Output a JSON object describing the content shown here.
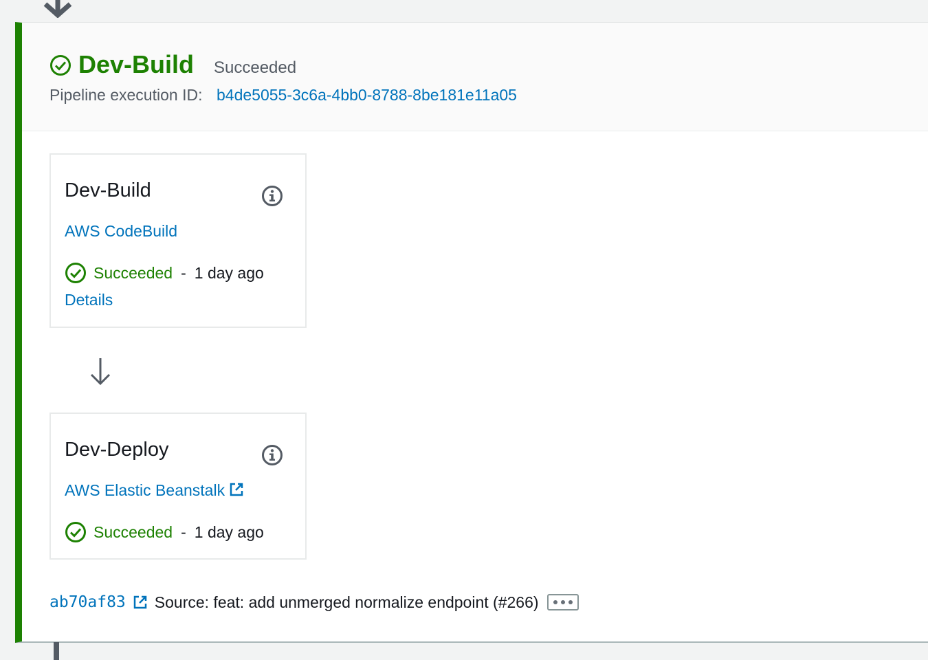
{
  "stage": {
    "title": "Dev-Build",
    "status": "Succeeded",
    "execution_id_label": "Pipeline execution ID:",
    "execution_id": "b4de5055-3c6a-4bb0-8788-8be181e11a05"
  },
  "actions": [
    {
      "name": "Dev-Build",
      "provider": "AWS CodeBuild",
      "status": "Succeeded",
      "separator": "-",
      "time_ago": "1 day ago",
      "details_label": "Details"
    },
    {
      "name": "Dev-Deploy",
      "provider": "AWS Elastic Beanstalk",
      "status": "Succeeded",
      "separator": "-",
      "time_ago": "1 day ago"
    }
  ],
  "source": {
    "commit_id": "ab70af83",
    "message": "Source: feat: add unmerged normalize endpoint (#266)"
  },
  "colors": {
    "success": "#1d8102",
    "link": "#0073bb",
    "muted": "#545b64"
  },
  "icons": [
    "arrow-down-icon",
    "check-circle-icon",
    "info-icon",
    "external-link-icon",
    "ellipsis-icon"
  ]
}
